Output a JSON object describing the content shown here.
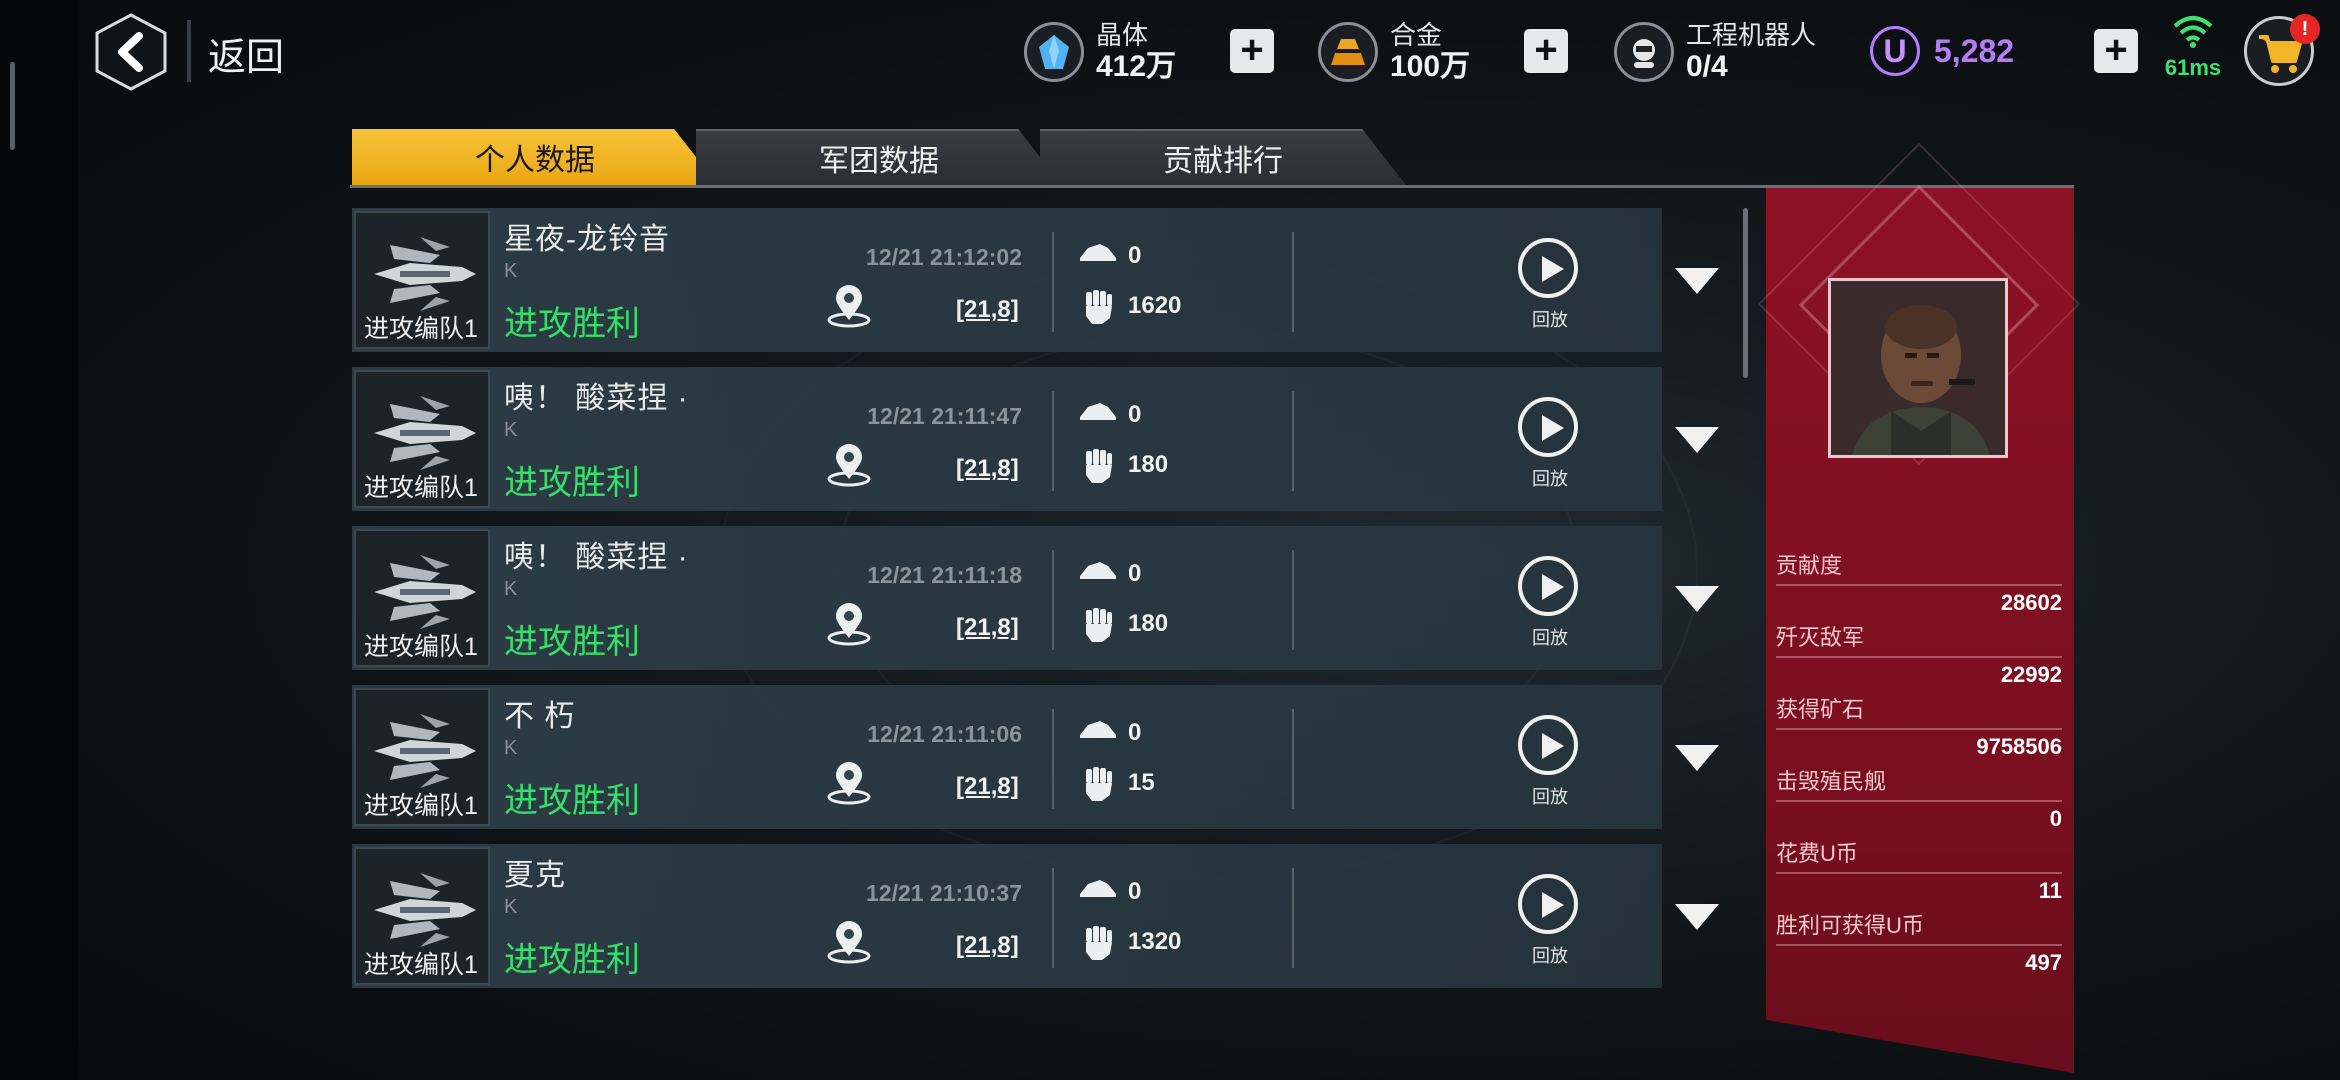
{
  "header": {
    "back_label": "返回",
    "resources": [
      {
        "label": "晶体",
        "value": "412万",
        "icon": "crystal-icon"
      },
      {
        "label": "合金",
        "value": "100万",
        "icon": "alloy-icon"
      },
      {
        "label": "工程机器人",
        "value": "0/4",
        "icon": "robot-icon"
      }
    ],
    "ucoin": {
      "symbol": "U",
      "value": "5,282"
    },
    "ping": "61ms",
    "cart_badge": "!"
  },
  "tabs": [
    {
      "label": "个人数据",
      "active": true
    },
    {
      "label": "军团数据",
      "active": false
    },
    {
      "label": "贡献排行",
      "active": false
    }
  ],
  "records": [
    {
      "thumb_label": "进攻编队1",
      "name": "星夜-龙铃音",
      "rank": "K",
      "result": "进攻胜利",
      "time": "12/21 21:12:02",
      "coord": "[21,8]",
      "stat1": "0",
      "stat2": "1620",
      "replay": "回放"
    },
    {
      "thumb_label": "进攻编队1",
      "name": "咦！ 酸菜捏 ·",
      "rank": "K",
      "result": "进攻胜利",
      "time": "12/21 21:11:47",
      "coord": "[21,8]",
      "stat1": "0",
      "stat2": "180",
      "replay": "回放"
    },
    {
      "thumb_label": "进攻编队1",
      "name": "咦！ 酸菜捏 ·",
      "rank": "K",
      "result": "进攻胜利",
      "time": "12/21 21:11:18",
      "coord": "[21,8]",
      "stat1": "0",
      "stat2": "180",
      "replay": "回放"
    },
    {
      "thumb_label": "进攻编队1",
      "name": "不 朽",
      "rank": "K",
      "result": "进攻胜利",
      "time": "12/21 21:11:06",
      "coord": "[21,8]",
      "stat1": "0",
      "stat2": "15",
      "replay": "回放"
    },
    {
      "thumb_label": "进攻编队1",
      "name": "夏克",
      "rank": "K",
      "result": "进攻胜利",
      "time": "12/21 21:10:37",
      "coord": "[21,8]",
      "stat1": "0",
      "stat2": "1320",
      "replay": "回放"
    }
  ],
  "summary": [
    {
      "label": "贡献度",
      "value": "28602"
    },
    {
      "label": "歼灭敌军",
      "value": "22992"
    },
    {
      "label": "获得矿石",
      "value": "9758506"
    },
    {
      "label": "击毁殖民舰",
      "value": "0"
    },
    {
      "label": "花费U币",
      "value": "11"
    },
    {
      "label": "胜利可获得U币",
      "value": "497"
    }
  ],
  "colors": {
    "accent_tab": "#f2b525",
    "win_text": "#34e06a",
    "panel": "#8c1225",
    "ucoin": "#b47df5",
    "ping": "#3fe070"
  }
}
